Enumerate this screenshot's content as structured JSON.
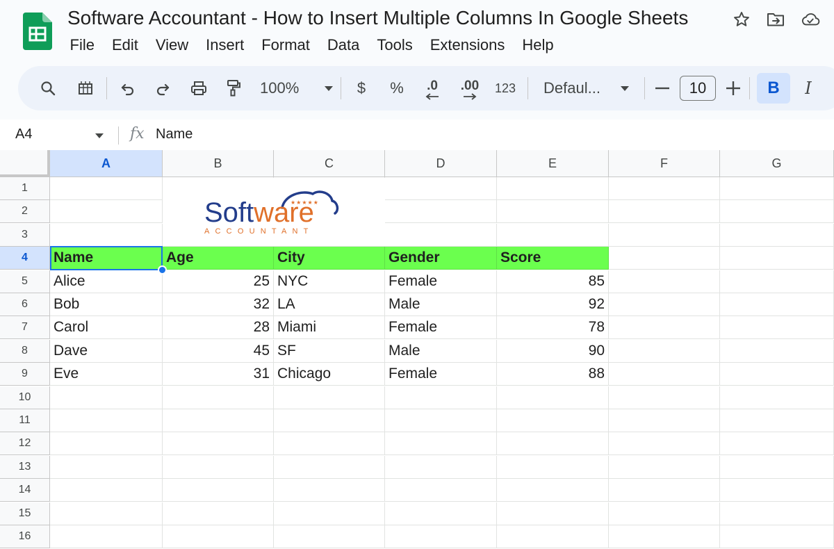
{
  "app": {
    "title": "Software Accountant - How to Insert Multiple Columns In Google Sheets"
  },
  "menu": [
    "File",
    "Edit",
    "View",
    "Insert",
    "Format",
    "Data",
    "Tools",
    "Extensions",
    "Help"
  ],
  "toolbar": {
    "zoom": "100%",
    "currency": "$",
    "percent": "%",
    "decrease_decimals": ".0",
    "increase_decimals": ".00",
    "number_format": "123",
    "font": "Defaul...",
    "font_size": "10",
    "bold": "B",
    "italic": "I"
  },
  "formula_bar": {
    "cell_ref": "A4",
    "fx": "fx",
    "value": "Name"
  },
  "grid": {
    "columns": [
      "A",
      "B",
      "C",
      "D",
      "E",
      "F",
      "G"
    ],
    "rows": [
      "1",
      "2",
      "3",
      "4",
      "5",
      "6",
      "7",
      "8",
      "9",
      "10",
      "11",
      "12",
      "13",
      "14",
      "15",
      "16"
    ],
    "selected_cell": "A4",
    "header_fill": "#6bff4e",
    "table": {
      "headers": [
        "Name",
        "Age",
        "City",
        "Gender",
        "Score"
      ],
      "rows": [
        [
          "Alice",
          "25",
          "NYC",
          "Female",
          "85"
        ],
        [
          "Bob",
          "32",
          "LA",
          "Male",
          "92"
        ],
        [
          "Carol",
          "28",
          "Miami",
          "Female",
          "78"
        ],
        [
          "Dave",
          "45",
          "SF",
          "Male",
          "90"
        ],
        [
          "Eve",
          "31",
          "Chicago",
          "Female",
          "88"
        ]
      ]
    }
  },
  "logo": {
    "text_part1": "Soft",
    "text_part2": "ware",
    "subtext": "ACCOUNTANT",
    "stars": "★★★★★",
    "colors": {
      "blue": "#233d8b",
      "orange": "#e0702a"
    }
  },
  "colors": {
    "accent": "#0b57d0",
    "selection": "#1a73e8",
    "sheets_green": "#0f9d58"
  }
}
